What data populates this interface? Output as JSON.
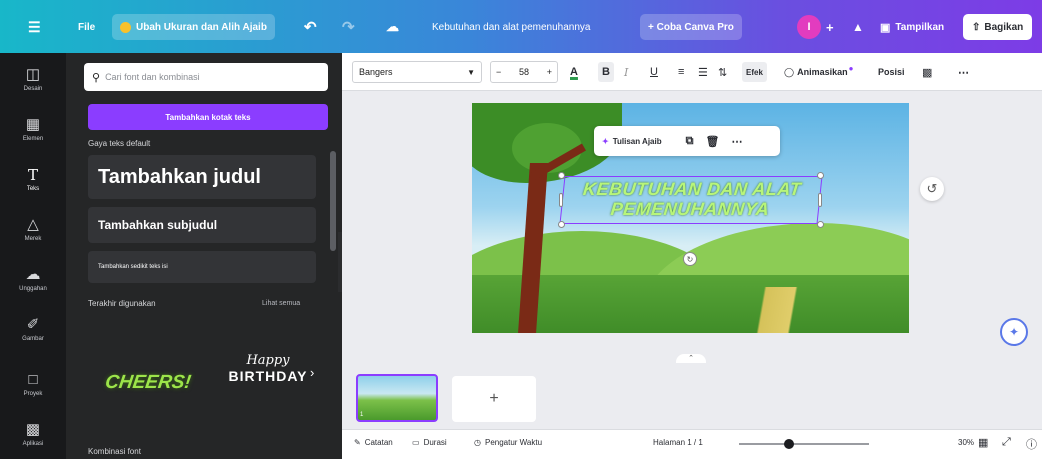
{
  "topbar": {
    "file_label": "File",
    "resize_label": "Ubah Ukuran dan Alih Ajaib",
    "doc_title": "Kebutuhan dan alat pemenuhannya",
    "trial_label": "+ Coba Canva Pro",
    "avatar_letter": "I",
    "view_label": "Tampilkan",
    "share_label": "Bagikan"
  },
  "rail": {
    "items": [
      {
        "label": "Desain",
        "icon": "layout-icon"
      },
      {
        "label": "Elemen",
        "icon": "shapes-icon"
      },
      {
        "label": "Teks",
        "icon": "text-icon"
      },
      {
        "label": "Merek",
        "icon": "brand-icon"
      },
      {
        "label": "Unggahan",
        "icon": "upload-icon"
      },
      {
        "label": "Gambar",
        "icon": "draw-icon"
      },
      {
        "label": "Proyek",
        "icon": "folder-icon"
      },
      {
        "label": "Aplikasi",
        "icon": "apps-icon"
      }
    ]
  },
  "panel": {
    "search_placeholder": "Cari font dan kombinasi",
    "add_textbox": "Tambahkan kotak teks",
    "default_styles_label": "Gaya teks default",
    "heading": "Tambahkan judul",
    "subheading": "Tambahkan subjudul",
    "body": "Tambahkan sedikit teks isi",
    "recent_label": "Terakhir digunakan",
    "see_all": "Lihat semua",
    "cheers": "CHEERS!",
    "happy": "Happy",
    "birthday": "BIRTHDAY",
    "combos_label": "Kombinasi font"
  },
  "toolbar": {
    "font": "Bangers",
    "size": "58",
    "effects": "Efek",
    "animate": "Animasikan",
    "position": "Posisi"
  },
  "canvas": {
    "headline": "KEBUTUHAN DAN ALAT PEMENUHANNYA",
    "float_menu": {
      "magic_write": "Tulisan Ajaib"
    }
  },
  "pages": {
    "thumb_number": "1"
  },
  "bottombar": {
    "notes": "Catatan",
    "duration": "Durasi",
    "timer": "Pengatur Waktu",
    "page_indicator": "Halaman 1 / 1",
    "zoom_label": "30%",
    "zoom_percent": 30
  },
  "colors": {
    "accent": "#8b3dff",
    "headline_fill": "#b8f57a",
    "panel_bg": "#252627",
    "rail_bg": "#18191b"
  }
}
